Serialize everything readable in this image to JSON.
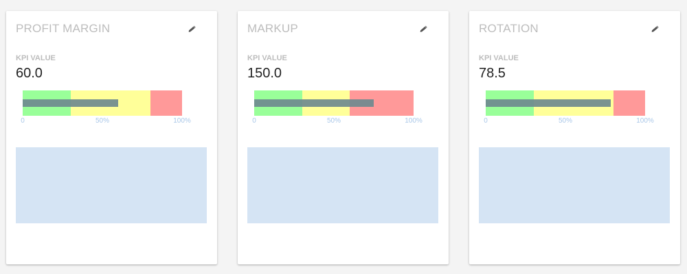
{
  "kpi_label": "KPI VALUE",
  "ticks": [
    "0",
    "50%",
    "100%"
  ],
  "colors": {
    "good": "#99ff99",
    "warning": "#ffff99",
    "bad": "#ff9999",
    "measure": "#6f8a8f",
    "panel": "#d5e4f4"
  },
  "cards": [
    {
      "title": "PROFIT MARGIN",
      "value": "60.0",
      "edit_icon": "pencil-icon",
      "bands_percent": {
        "green_end": 30,
        "yellow_end": 80,
        "red_end": 100
      },
      "measure_percent": 60
    },
    {
      "title": "MARKUP",
      "value": "150.0",
      "edit_icon": "pencil-icon",
      "bands_percent": {
        "green_end": 30,
        "yellow_end": 60,
        "red_end": 100
      },
      "measure_percent": 75
    },
    {
      "title": "ROTATION",
      "value": "78.5",
      "edit_icon": "pencil-icon",
      "bands_percent": {
        "green_end": 30,
        "yellow_end": 80,
        "red_end": 100
      },
      "measure_percent": 78.5
    }
  ]
}
